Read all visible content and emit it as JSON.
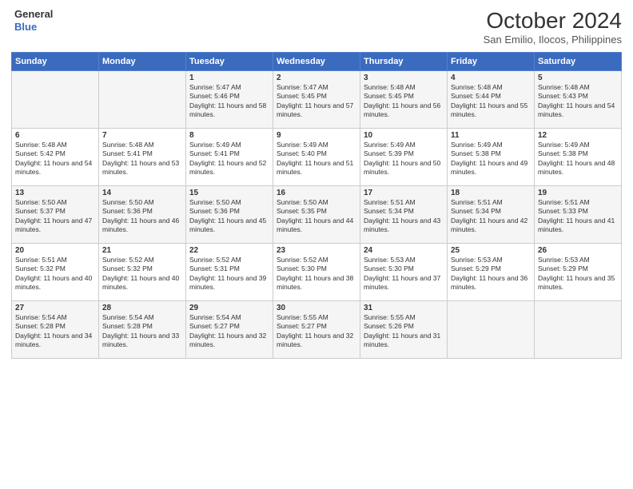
{
  "header": {
    "logo_line1": "General",
    "logo_line2": "Blue",
    "month": "October 2024",
    "location": "San Emilio, Ilocos, Philippines"
  },
  "columns": [
    "Sunday",
    "Monday",
    "Tuesday",
    "Wednesday",
    "Thursday",
    "Friday",
    "Saturday"
  ],
  "weeks": [
    [
      {
        "day": "",
        "sunrise": "",
        "sunset": "",
        "daylight": ""
      },
      {
        "day": "",
        "sunrise": "",
        "sunset": "",
        "daylight": ""
      },
      {
        "day": "1",
        "sunrise": "Sunrise: 5:47 AM",
        "sunset": "Sunset: 5:46 PM",
        "daylight": "Daylight: 11 hours and 58 minutes."
      },
      {
        "day": "2",
        "sunrise": "Sunrise: 5:47 AM",
        "sunset": "Sunset: 5:45 PM",
        "daylight": "Daylight: 11 hours and 57 minutes."
      },
      {
        "day": "3",
        "sunrise": "Sunrise: 5:48 AM",
        "sunset": "Sunset: 5:45 PM",
        "daylight": "Daylight: 11 hours and 56 minutes."
      },
      {
        "day": "4",
        "sunrise": "Sunrise: 5:48 AM",
        "sunset": "Sunset: 5:44 PM",
        "daylight": "Daylight: 11 hours and 55 minutes."
      },
      {
        "day": "5",
        "sunrise": "Sunrise: 5:48 AM",
        "sunset": "Sunset: 5:43 PM",
        "daylight": "Daylight: 11 hours and 54 minutes."
      }
    ],
    [
      {
        "day": "6",
        "sunrise": "Sunrise: 5:48 AM",
        "sunset": "Sunset: 5:42 PM",
        "daylight": "Daylight: 11 hours and 54 minutes."
      },
      {
        "day": "7",
        "sunrise": "Sunrise: 5:48 AM",
        "sunset": "Sunset: 5:41 PM",
        "daylight": "Daylight: 11 hours and 53 minutes."
      },
      {
        "day": "8",
        "sunrise": "Sunrise: 5:49 AM",
        "sunset": "Sunset: 5:41 PM",
        "daylight": "Daylight: 11 hours and 52 minutes."
      },
      {
        "day": "9",
        "sunrise": "Sunrise: 5:49 AM",
        "sunset": "Sunset: 5:40 PM",
        "daylight": "Daylight: 11 hours and 51 minutes."
      },
      {
        "day": "10",
        "sunrise": "Sunrise: 5:49 AM",
        "sunset": "Sunset: 5:39 PM",
        "daylight": "Daylight: 11 hours and 50 minutes."
      },
      {
        "day": "11",
        "sunrise": "Sunrise: 5:49 AM",
        "sunset": "Sunset: 5:38 PM",
        "daylight": "Daylight: 11 hours and 49 minutes."
      },
      {
        "day": "12",
        "sunrise": "Sunrise: 5:49 AM",
        "sunset": "Sunset: 5:38 PM",
        "daylight": "Daylight: 11 hours and 48 minutes."
      }
    ],
    [
      {
        "day": "13",
        "sunrise": "Sunrise: 5:50 AM",
        "sunset": "Sunset: 5:37 PM",
        "daylight": "Daylight: 11 hours and 47 minutes."
      },
      {
        "day": "14",
        "sunrise": "Sunrise: 5:50 AM",
        "sunset": "Sunset: 5:36 PM",
        "daylight": "Daylight: 11 hours and 46 minutes."
      },
      {
        "day": "15",
        "sunrise": "Sunrise: 5:50 AM",
        "sunset": "Sunset: 5:36 PM",
        "daylight": "Daylight: 11 hours and 45 minutes."
      },
      {
        "day": "16",
        "sunrise": "Sunrise: 5:50 AM",
        "sunset": "Sunset: 5:35 PM",
        "daylight": "Daylight: 11 hours and 44 minutes."
      },
      {
        "day": "17",
        "sunrise": "Sunrise: 5:51 AM",
        "sunset": "Sunset: 5:34 PM",
        "daylight": "Daylight: 11 hours and 43 minutes."
      },
      {
        "day": "18",
        "sunrise": "Sunrise: 5:51 AM",
        "sunset": "Sunset: 5:34 PM",
        "daylight": "Daylight: 11 hours and 42 minutes."
      },
      {
        "day": "19",
        "sunrise": "Sunrise: 5:51 AM",
        "sunset": "Sunset: 5:33 PM",
        "daylight": "Daylight: 11 hours and 41 minutes."
      }
    ],
    [
      {
        "day": "20",
        "sunrise": "Sunrise: 5:51 AM",
        "sunset": "Sunset: 5:32 PM",
        "daylight": "Daylight: 11 hours and 40 minutes."
      },
      {
        "day": "21",
        "sunrise": "Sunrise: 5:52 AM",
        "sunset": "Sunset: 5:32 PM",
        "daylight": "Daylight: 11 hours and 40 minutes."
      },
      {
        "day": "22",
        "sunrise": "Sunrise: 5:52 AM",
        "sunset": "Sunset: 5:31 PM",
        "daylight": "Daylight: 11 hours and 39 minutes."
      },
      {
        "day": "23",
        "sunrise": "Sunrise: 5:52 AM",
        "sunset": "Sunset: 5:30 PM",
        "daylight": "Daylight: 11 hours and 38 minutes."
      },
      {
        "day": "24",
        "sunrise": "Sunrise: 5:53 AM",
        "sunset": "Sunset: 5:30 PM",
        "daylight": "Daylight: 11 hours and 37 minutes."
      },
      {
        "day": "25",
        "sunrise": "Sunrise: 5:53 AM",
        "sunset": "Sunset: 5:29 PM",
        "daylight": "Daylight: 11 hours and 36 minutes."
      },
      {
        "day": "26",
        "sunrise": "Sunrise: 5:53 AM",
        "sunset": "Sunset: 5:29 PM",
        "daylight": "Daylight: 11 hours and 35 minutes."
      }
    ],
    [
      {
        "day": "27",
        "sunrise": "Sunrise: 5:54 AM",
        "sunset": "Sunset: 5:28 PM",
        "daylight": "Daylight: 11 hours and 34 minutes."
      },
      {
        "day": "28",
        "sunrise": "Sunrise: 5:54 AM",
        "sunset": "Sunset: 5:28 PM",
        "daylight": "Daylight: 11 hours and 33 minutes."
      },
      {
        "day": "29",
        "sunrise": "Sunrise: 5:54 AM",
        "sunset": "Sunset: 5:27 PM",
        "daylight": "Daylight: 11 hours and 32 minutes."
      },
      {
        "day": "30",
        "sunrise": "Sunrise: 5:55 AM",
        "sunset": "Sunset: 5:27 PM",
        "daylight": "Daylight: 11 hours and 32 minutes."
      },
      {
        "day": "31",
        "sunrise": "Sunrise: 5:55 AM",
        "sunset": "Sunset: 5:26 PM",
        "daylight": "Daylight: 11 hours and 31 minutes."
      },
      {
        "day": "",
        "sunrise": "",
        "sunset": "",
        "daylight": ""
      },
      {
        "day": "",
        "sunrise": "",
        "sunset": "",
        "daylight": ""
      }
    ]
  ]
}
